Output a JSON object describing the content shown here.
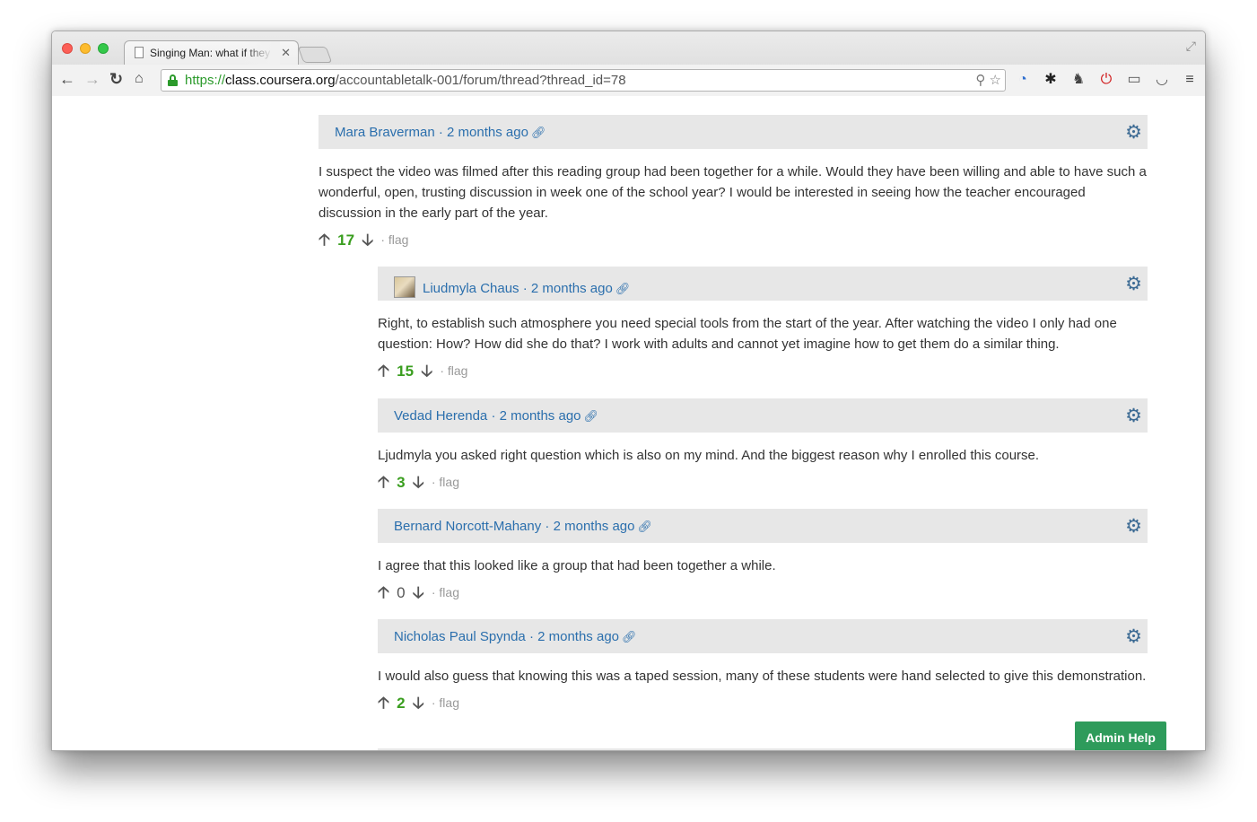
{
  "browser": {
    "tab_title": "Singing Man: what if they c",
    "url_scheme": "https://",
    "url_host": "class.coursera.org",
    "url_path": "/accountabletalk-001/forum/thread?thread_id=78"
  },
  "posts": [
    {
      "author": "Mara Braverman",
      "time": "2 months ago",
      "body": "I suspect the video was filmed after this reading group had been together for a while. Would they have been willing and able to have such a wonderful, open, trusting discussion in week one of the school year? I would be interested in seeing how the teacher encouraged discussion in the early part of the year.",
      "score": "17",
      "flag": "flag"
    },
    {
      "author": "Liudmyla Chaus",
      "time": "2 months ago",
      "body": "Right, to establish such atmosphere you need special tools from the start of the year. After watching the video I only had one question: How? How did she do that? I work with adults and cannot yet imagine how to get them do a similar thing.",
      "score": "15",
      "flag": "flag"
    },
    {
      "author": "Vedad Herenda",
      "time": "2 months ago",
      "body": "Ljudmyla you asked right question which is also on my mind. And the biggest reason why I enrolled this course.",
      "score": "3",
      "flag": "flag"
    },
    {
      "author": "Bernard Norcott-Mahany",
      "time": "2 months ago",
      "body": "I agree that this looked like a group that had been together a while.",
      "score": "0",
      "flag": "flag"
    },
    {
      "author": "Nicholas Paul Spynda",
      "time": "2 months ago",
      "body": "I would also guess that knowing this was a taped session, many of these students were hand selected to give this demonstration.",
      "score": "2",
      "flag": "flag"
    }
  ],
  "separator": "·",
  "admin_help_label": "Admin Help",
  "colors": {
    "link": "#2b6fad",
    "score_positive": "#3a9e1f",
    "admin_help": "#2e9b5b",
    "header_bg": "#e7e7e7"
  }
}
